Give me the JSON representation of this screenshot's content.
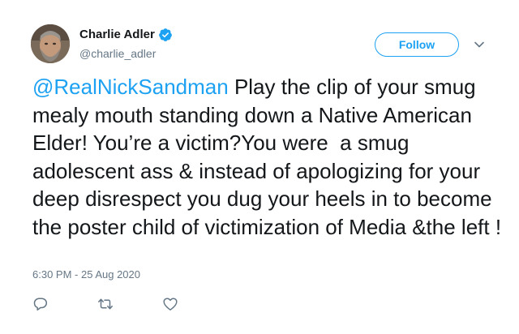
{
  "tweet": {
    "author": {
      "display_name": "Charlie Adler",
      "handle": "@charlie_adler",
      "verified": true
    },
    "follow_label": "Follow",
    "mention": "@RealNickSandman",
    "body": " Play the clip of your smug mealy mouth standing down a Native American Elder! You’re a victim?You were  a smug adolescent ass & instead of apologizing for your deep disrespect you dug your heels in to become the poster child of victimization of Media &the left !",
    "timestamp": "6:30 PM - 25 Aug 2020"
  },
  "icons": {
    "verified": "verified-badge-icon",
    "menu": "chevron-down-icon",
    "reply": "reply-icon",
    "retweet": "retweet-icon",
    "like": "heart-icon"
  },
  "colors": {
    "accent": "#1da1f2",
    "text": "#14171a",
    "secondary": "#657786"
  }
}
